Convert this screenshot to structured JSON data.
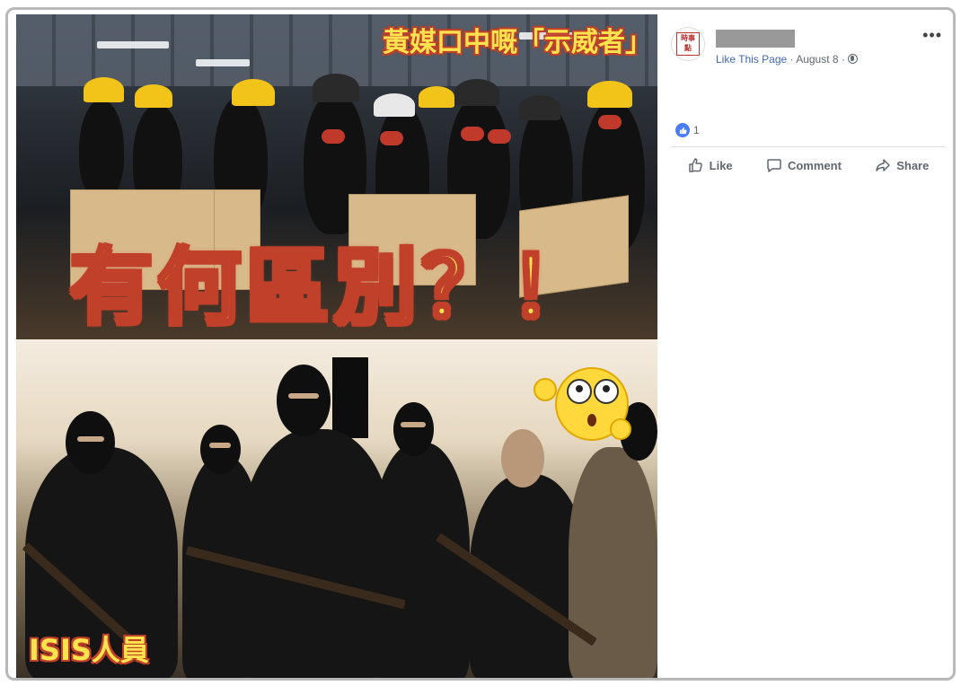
{
  "image": {
    "top_caption": "黃媒口中嘅「示威者」",
    "headline": "有何區別？！",
    "bottom_caption": "ISIS人員"
  },
  "post": {
    "page_avatar_text": "時事\n點",
    "meta_link": "Like This Page",
    "meta_separator": " · ",
    "date": "August 8",
    "date_separator": " · ",
    "more_icon": "more-options-icon",
    "reaction_count": "1",
    "actions": {
      "like": "Like",
      "comment": "Comment",
      "share": "Share"
    }
  },
  "colors": {
    "link": "#4267b2",
    "meta": "#606770",
    "caption_fill": "#ffe34d",
    "caption_stroke": "#c0402a",
    "reaction_blue": "#4a7cf6"
  }
}
